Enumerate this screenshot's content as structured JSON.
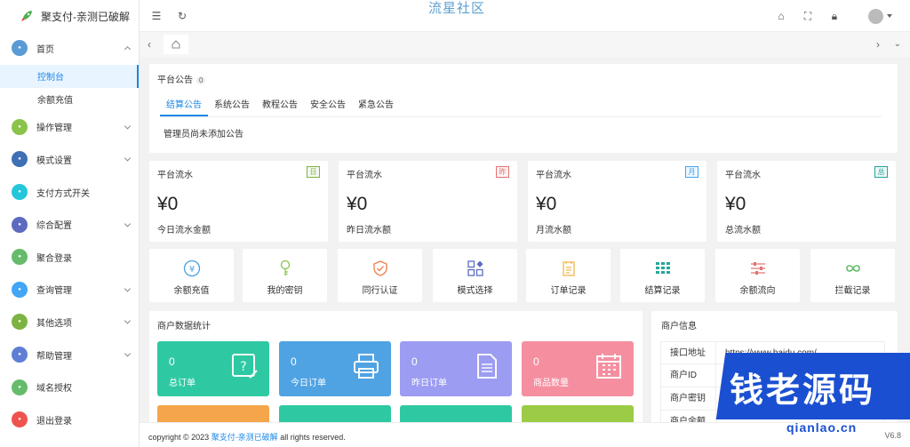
{
  "app": {
    "title": "聚支付-亲测已破解",
    "brand_center": "流星社区"
  },
  "sidebar": {
    "items": [
      {
        "label": "首页",
        "color": "#5b9bd5",
        "icon": "home-icon",
        "chev": "up"
      },
      {
        "label": "操作管理",
        "color": "#8bc34a",
        "icon": "list-icon",
        "chev": "down"
      },
      {
        "label": "模式设置",
        "color": "#3f6fb5",
        "icon": "grid-icon",
        "chev": "down"
      },
      {
        "label": "支付方式开关",
        "color": "#26c6da",
        "icon": "toggle-icon",
        "chev": ""
      },
      {
        "label": "综合配置",
        "color": "#5c6bc0",
        "icon": "settings-icon",
        "chev": "down"
      },
      {
        "label": "聚合登录",
        "color": "#66bb6a",
        "icon": "login-icon",
        "chev": ""
      },
      {
        "label": "查询管理",
        "color": "#42a5f5",
        "icon": "search-icon",
        "chev": "down"
      },
      {
        "label": "其他选项",
        "color": "#7cb342",
        "icon": "more-icon",
        "chev": "down"
      },
      {
        "label": "帮助管理",
        "color": "#5e7fd5",
        "icon": "help-icon",
        "chev": "down"
      },
      {
        "label": "域名授权",
        "color": "#66bb6a",
        "icon": "check-icon",
        "chev": ""
      },
      {
        "label": "退出登录",
        "color": "#ef5350",
        "icon": "logout-icon",
        "chev": ""
      }
    ],
    "subitems": [
      {
        "label": "控制台",
        "active": true
      },
      {
        "label": "余额充值",
        "active": false
      }
    ]
  },
  "notice": {
    "title": "平台公告",
    "count": "0",
    "tabs": [
      "结算公告",
      "系统公告",
      "教程公告",
      "安全公告",
      "紧急公告"
    ],
    "empty": "管理员尚未添加公告"
  },
  "flows": [
    {
      "title": "平台流水",
      "tag": "日",
      "tag_color": "#7cb342",
      "amount": "¥0",
      "label": "今日流水金额"
    },
    {
      "title": "平台流水",
      "tag": "昨",
      "tag_color": "#e57373",
      "amount": "¥0",
      "label": "昨日流水额"
    },
    {
      "title": "平台流水",
      "tag": "月",
      "tag_color": "#42a5f5",
      "amount": "¥0",
      "label": "月流水额"
    },
    {
      "title": "平台流水",
      "tag": "总",
      "tag_color": "#26a69a",
      "amount": "¥0",
      "label": "总流水额"
    }
  ],
  "quick": [
    {
      "label": "余额充值",
      "icon": "yen-icon",
      "color": "#4aa3df"
    },
    {
      "label": "我的密钥",
      "icon": "key-icon",
      "color": "#8bc34a"
    },
    {
      "label": "同行认证",
      "icon": "shield-icon",
      "color": "#ef7b4a"
    },
    {
      "label": "模式选择",
      "icon": "apps-icon",
      "color": "#5c6bc0"
    },
    {
      "label": "订单记录",
      "icon": "doc-icon",
      "color": "#f0b84a"
    },
    {
      "label": "结算记录",
      "icon": "table-icon",
      "color": "#26a69a"
    },
    {
      "label": "余额流向",
      "icon": "sliders-icon",
      "color": "#e57373"
    },
    {
      "label": "拦截记录",
      "icon": "infinity-icon",
      "color": "#66bb6a"
    }
  ],
  "stats": {
    "title": "商户数据统计",
    "boxes": [
      {
        "value": "0",
        "label": "总订单",
        "color": "#2ec9a3",
        "icon": "edit-icon"
      },
      {
        "value": "0",
        "label": "今日订单",
        "color": "#4fa3e3",
        "icon": "printer-icon"
      },
      {
        "value": "0",
        "label": "昨日订单",
        "color": "#9c9cf2",
        "icon": "document-icon"
      },
      {
        "value": "0",
        "label": "商品数量",
        "color": "#f58fa0",
        "icon": "calendar-icon"
      }
    ],
    "row2_colors": [
      "#f5a54a",
      "#2ec9a3",
      "#2ec9a3",
      "#9ccc45"
    ]
  },
  "merchant": {
    "title": "商户信息",
    "rows": [
      {
        "key": "接口地址",
        "value": "https://www.baidu.com/"
      },
      {
        "key": "商户ID",
        "value": ""
      },
      {
        "key": "商户密钥",
        "value": ""
      },
      {
        "key": "商户余额",
        "value": ""
      }
    ]
  },
  "footer": {
    "prefix": "copyright © 2023 ",
    "link": "聚支付-亲测已破解",
    "suffix": " all rights reserved.",
    "version": "V6.8"
  },
  "watermark": {
    "text": "钱老源码",
    "url": "qianlao.cn"
  }
}
